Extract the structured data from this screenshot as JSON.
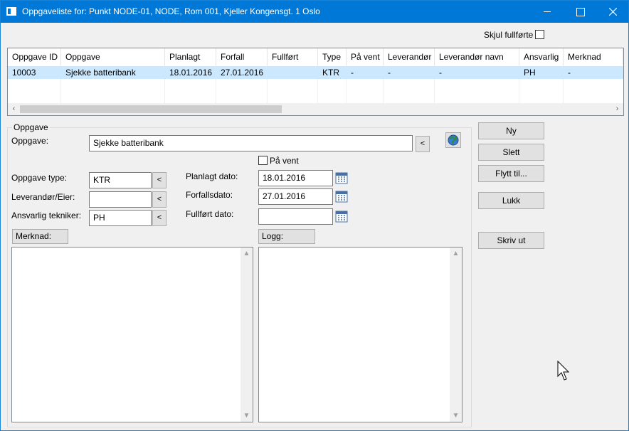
{
  "window": {
    "title": "Oppgaveliste for: Punkt NODE-01, NODE, Rom 001, Kjeller Kongensgt. 1 Oslo",
    "title_bar_color": "#0078d7",
    "selection_color": "#cce8ff"
  },
  "filter": {
    "hide_done_label": "Skjul fullførte",
    "hide_done_checked": false
  },
  "table": {
    "columns": [
      "Oppgave ID",
      "Oppgave",
      "Planlagt",
      "Forfall",
      "Fullført",
      "Type",
      "På vent",
      "Leverandør",
      "Leverandør navn",
      "Ansvarlig",
      "Merknad"
    ],
    "rows": [
      [
        "10003",
        "Sjekke batteribank",
        "18.01.2016",
        "27.01.2016",
        "",
        "KTR",
        "-",
        "-",
        "-",
        "PH",
        "-"
      ]
    ],
    "scroll_left_icon": "chevron-left-icon",
    "scroll_right_icon": "chevron-right-icon"
  },
  "form": {
    "group_title": "Oppgave",
    "task_label": "Oppgave:",
    "task_value": "Sjekke batteribank",
    "on_hold_label": "På vent",
    "on_hold_checked": false,
    "type_label": "Oppgave type:",
    "type_value": "KTR",
    "supplier_label": "Leverandør/Eier:",
    "supplier_value": "",
    "tech_label": "Ansvarlig tekniker:",
    "tech_value": "PH",
    "planned_label": "Planlagt dato:",
    "planned_value": "18.01.2016",
    "due_label": "Forfallsdato:",
    "due_value": "27.01.2016",
    "done_label": "Fullført dato:",
    "done_value": "",
    "picker_label": "<",
    "remark_label": "Merknad:",
    "log_label": "Logg:",
    "remark_text": "",
    "log_text": ""
  },
  "buttons": {
    "new": "Ny",
    "delete": "Slett",
    "move": "Flytt til...",
    "close": "Lukk",
    "print": "Skriv ut"
  },
  "icons": {
    "globe": "globe-icon",
    "calendar": "calendar-icon"
  }
}
